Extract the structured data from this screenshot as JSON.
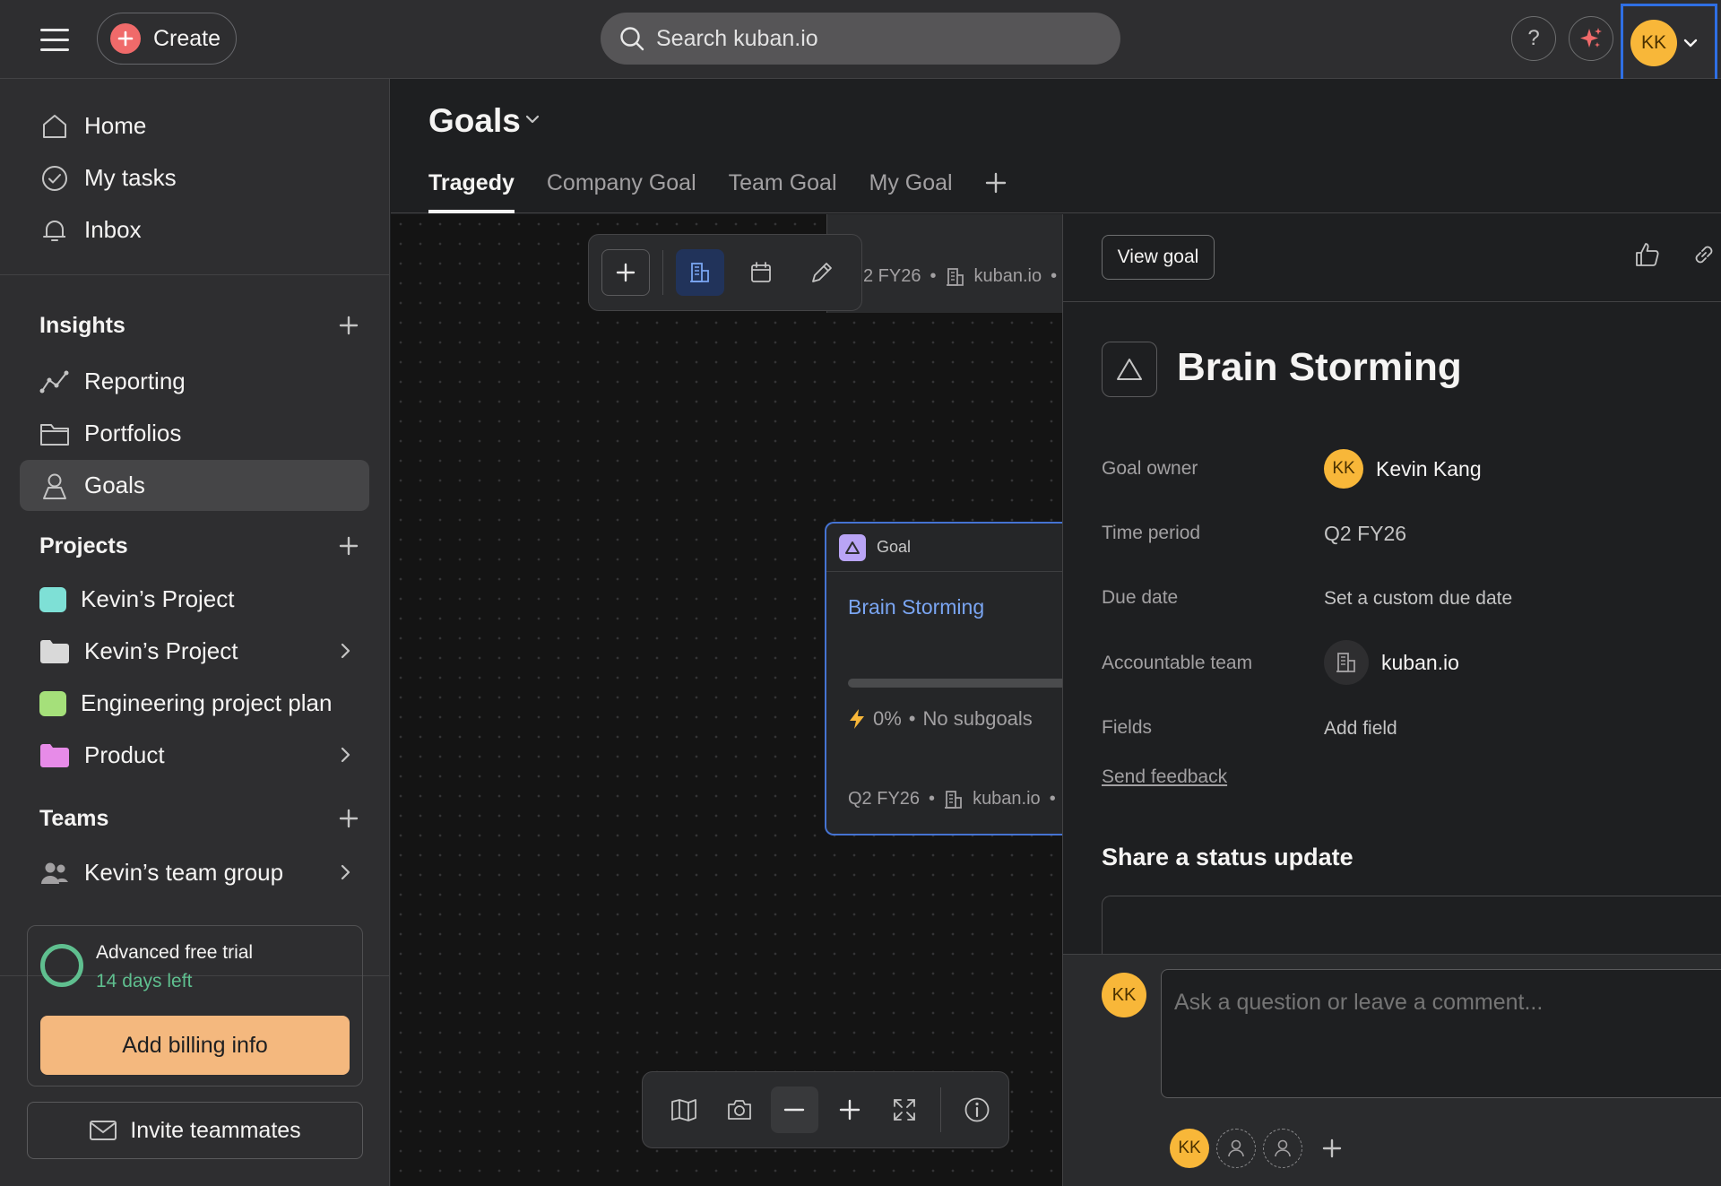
{
  "topbar": {
    "create_label": "Create",
    "search_placeholder": "Search kuban.io",
    "help_label": "?",
    "user_initials": "KK"
  },
  "sidebar": {
    "nav": [
      {
        "label": "Home",
        "icon": "home-icon"
      },
      {
        "label": "My tasks",
        "icon": "check-circle-icon"
      },
      {
        "label": "Inbox",
        "icon": "bell-icon"
      }
    ],
    "insights": {
      "title": "Insights",
      "items": [
        {
          "label": "Reporting",
          "icon": "chart-line-icon"
        },
        {
          "label": "Portfolios",
          "icon": "folder-icon"
        },
        {
          "label": "Goals",
          "icon": "goal-person-icon",
          "active": true
        }
      ]
    },
    "projects": {
      "title": "Projects",
      "items": [
        {
          "label": "Kevin’s Project",
          "color": "#7ee0d6"
        },
        {
          "label": "Kevin’s Project",
          "color": "#d9d9d9",
          "folder": true
        },
        {
          "label": "Engineering project plan",
          "color": "#a5e07a"
        },
        {
          "label": "Product",
          "color": "#e78be8",
          "folder": true
        }
      ]
    },
    "teams": {
      "title": "Teams",
      "items": [
        {
          "label": "Kevin’s team group",
          "icon": "team-icon"
        }
      ]
    },
    "trial": {
      "title": "Advanced free trial",
      "days_left": "14 days left",
      "billing_label": "Add billing info"
    },
    "invite_label": "Invite teammates"
  },
  "main": {
    "title": "Goals",
    "tabs": [
      {
        "label": "Tragedy",
        "active": true
      },
      {
        "label": "Company Goal"
      },
      {
        "label": "Team Goal"
      },
      {
        "label": "My Goal"
      }
    ]
  },
  "canvas": {
    "bg_card_period": "2 FY26",
    "bg_card_team": "kuban.io",
    "goal_card": {
      "type_label": "Goal",
      "title": "Brain Storming",
      "progress_percent": 0,
      "progress_label": "0%",
      "subgoals_label": "No subgoals",
      "period": "Q2 FY26",
      "team": "kuban.io",
      "dot": "•"
    }
  },
  "panel": {
    "view_goal_label": "View goal",
    "title": "Brain Storming",
    "fields": {
      "owner_label": "Goal owner",
      "owner_initials": "KK",
      "owner_name": "Kevin Kang",
      "period_label": "Time period",
      "period_value": "Q2 FY26",
      "due_label": "Due date",
      "due_value": "Set a custom due date",
      "team_label": "Accountable team",
      "team_value": "kuban.io",
      "fields_label": "Fields",
      "fields_value": "Add field"
    },
    "feedback_label": "Send feedback",
    "share_title": "Share a status update",
    "comment_placeholder": "Ask a question or leave a comment...",
    "commenter_initials": "KK",
    "collaborator_initials": "KK"
  },
  "colors": {
    "accent_blue": "#4573d2",
    "create_red": "#f06a6a",
    "avatar_yellow": "#f8b739",
    "trial_green": "#5fbf8f",
    "billing_orange": "#f4b87e",
    "goal_purple": "#b9a4f5"
  }
}
